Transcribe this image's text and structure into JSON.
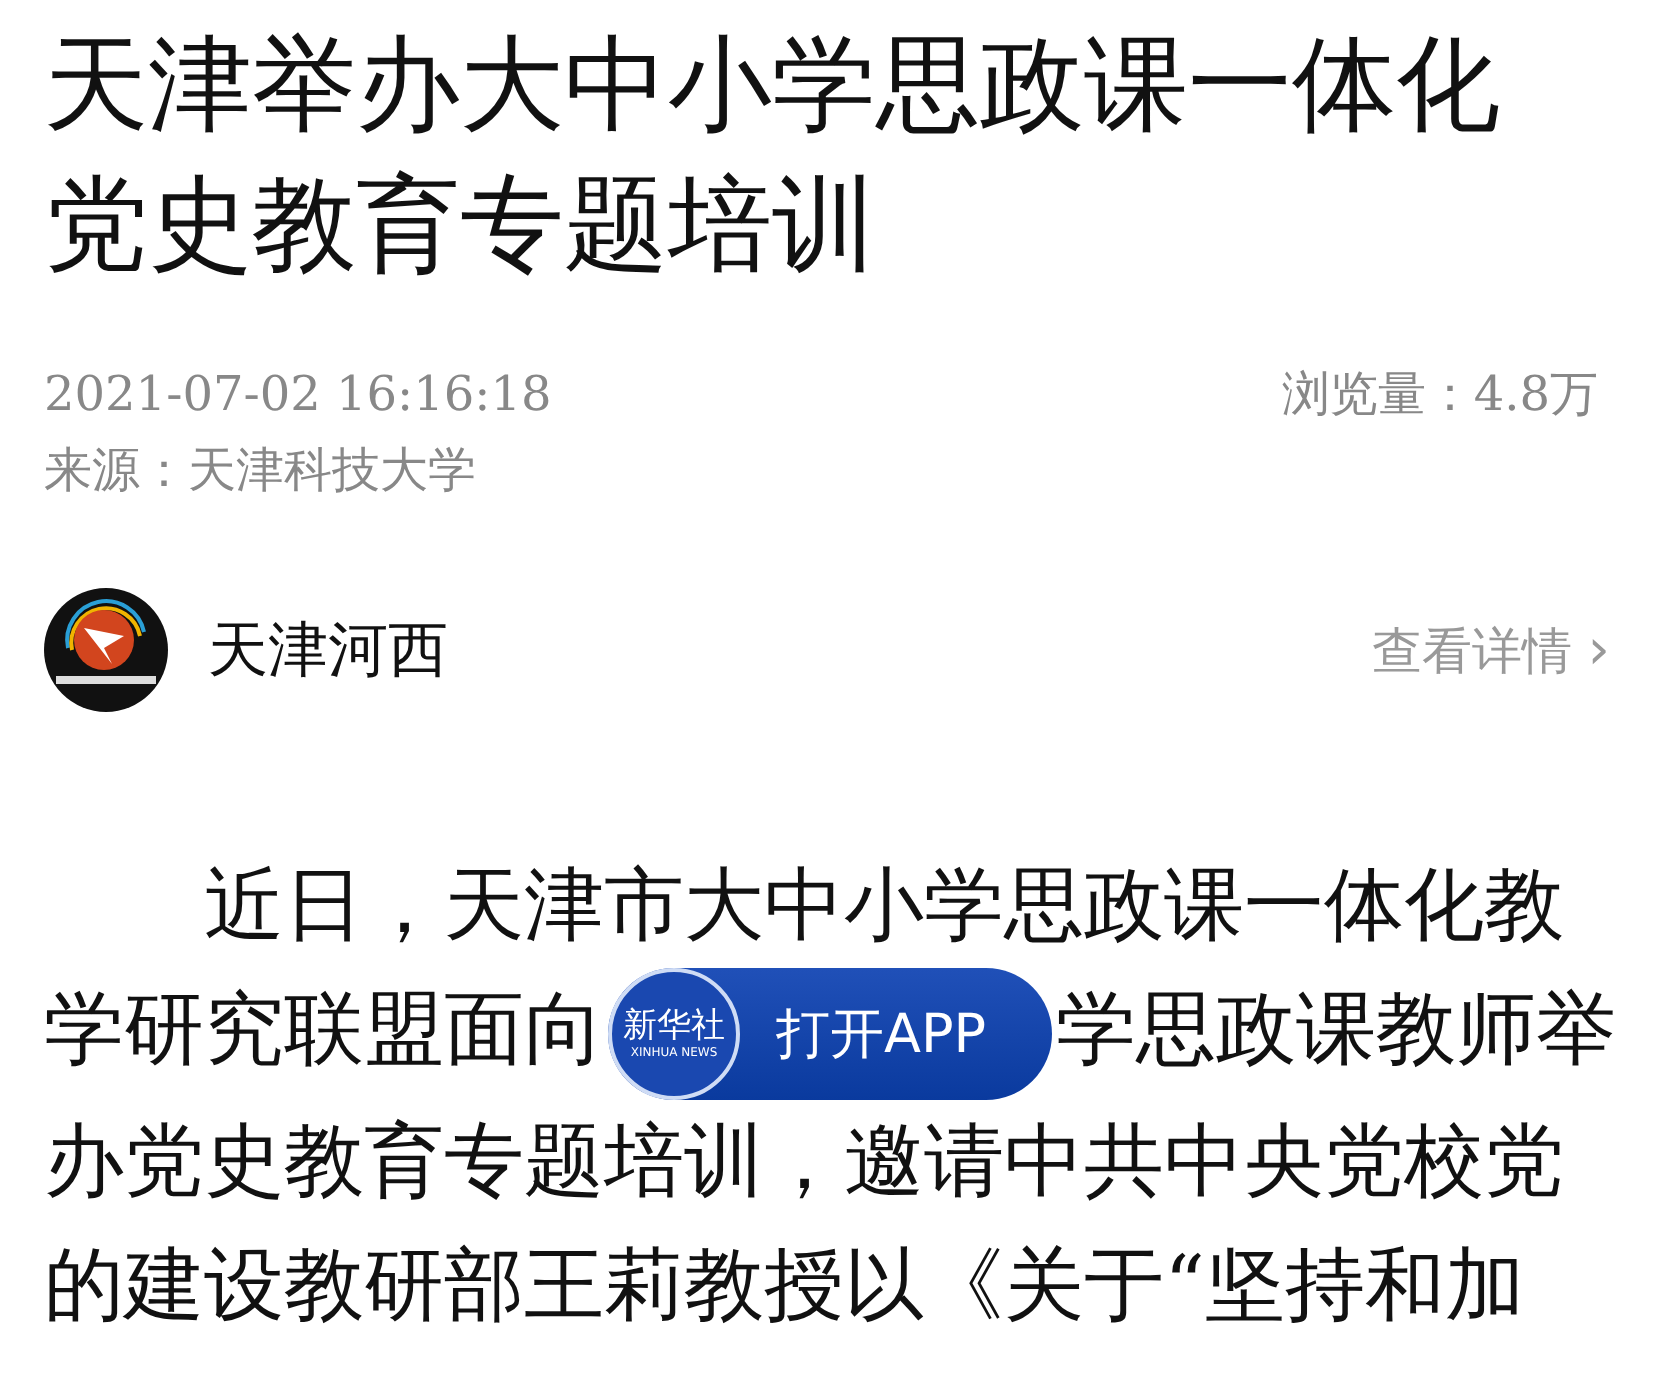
{
  "title_lines": [
    "天津举办大中小学思政课一体化",
    "党史教育专题培训"
  ],
  "meta": {
    "datetime": "2021-07-02 16:16:18",
    "views": "浏览量：4.8万",
    "source": "来源：天津科技大学"
  },
  "author": {
    "name": "天津河西",
    "details_link": "查看详情",
    "chevron": "›"
  },
  "body_lines": [
    {
      "indent": true,
      "parts": [
        "近日，天津市大中小学思政课一体化教"
      ]
    },
    {
      "indent": false,
      "parts": [
        "学研究联盟面向",
        "学思政课教师举"
      ]
    },
    {
      "indent": false,
      "parts": [
        "办党史教育专题培训，邀请中共中央党校党"
      ]
    },
    {
      "indent": false,
      "parts": [
        "的建设教研部王莉教授以《关于“坚持和加"
      ]
    }
  ],
  "open_app_banner": {
    "logo_text": "新华社",
    "logo_subtext": "XINHUA NEWS",
    "label": "打开APP"
  }
}
